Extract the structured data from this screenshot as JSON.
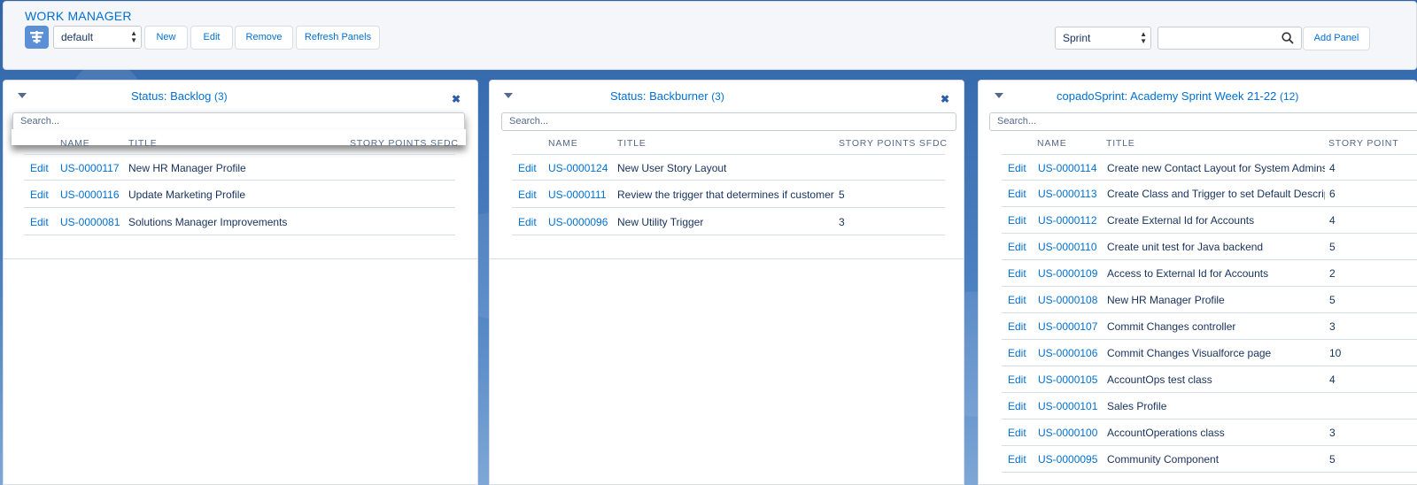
{
  "header": {
    "title": "WORK MANAGER",
    "view_select": "default",
    "buttons": {
      "new": "New",
      "edit": "Edit",
      "remove": "Remove",
      "refresh": "Refresh Panels"
    },
    "panel_type_select": "Sprint",
    "search_value": "",
    "add_panel": "Add Panel"
  },
  "columns": {
    "name": "NAME",
    "title": "TITLE",
    "points": "STORY POINTS SFDC"
  },
  "panels": [
    {
      "title": "Status: Backlog",
      "count": "(3)",
      "search_placeholder": "Search...",
      "rows": [
        {
          "edit": "Edit",
          "name": "US-0000117",
          "title": "New HR Manager Profile",
          "points": ""
        },
        {
          "edit": "Edit",
          "name": "US-0000116",
          "title": "Update Marketing Profile",
          "points": ""
        },
        {
          "edit": "Edit",
          "name": "US-0000081",
          "title": "Solutions Manager Improvements",
          "points": ""
        }
      ]
    },
    {
      "title": "Status: Backburner",
      "count": "(3)",
      "search_placeholder": "Search...",
      "rows": [
        {
          "edit": "Edit",
          "name": "US-0000124",
          "title": "New User Story Layout",
          "points": ""
        },
        {
          "edit": "Edit",
          "name": "US-0000111",
          "title": "Review the trigger that determines if customer is",
          "points": "5"
        },
        {
          "edit": "Edit",
          "name": "US-0000096",
          "title": "New Utility Trigger",
          "points": "3"
        }
      ]
    },
    {
      "title": "copadoSprint: Academy Sprint Week 21-22",
      "count": "(12)",
      "search_placeholder": "Search...",
      "points_header": "STORY POINT",
      "rows": [
        {
          "edit": "Edit",
          "name": "US-0000114",
          "title": "Create new Contact Layout for System Admins",
          "points": "4"
        },
        {
          "edit": "Edit",
          "name": "US-0000113",
          "title": "Create Class and Trigger to set Default Descriptio",
          "points": "6"
        },
        {
          "edit": "Edit",
          "name": "US-0000112",
          "title": "Create External Id for Accounts",
          "points": "4"
        },
        {
          "edit": "Edit",
          "name": "US-0000110",
          "title": "Create unit test for Java backend",
          "points": "5"
        },
        {
          "edit": "Edit",
          "name": "US-0000109",
          "title": "Access to External Id for Accounts",
          "points": "2"
        },
        {
          "edit": "Edit",
          "name": "US-0000108",
          "title": "New HR Manager Profile",
          "points": "5"
        },
        {
          "edit": "Edit",
          "name": "US-0000107",
          "title": "Commit Changes controller",
          "points": "3"
        },
        {
          "edit": "Edit",
          "name": "US-0000106",
          "title": "Commit Changes Visualforce page",
          "points": "10"
        },
        {
          "edit": "Edit",
          "name": "US-0000105",
          "title": "AccountOps test class",
          "points": "4"
        },
        {
          "edit": "Edit",
          "name": "US-0000101",
          "title": "Sales Profile",
          "points": ""
        },
        {
          "edit": "Edit",
          "name": "US-0000100",
          "title": "AccountOperations class",
          "points": "3"
        },
        {
          "edit": "Edit",
          "name": "US-0000095",
          "title": "Community Component",
          "points": "5"
        }
      ]
    }
  ]
}
